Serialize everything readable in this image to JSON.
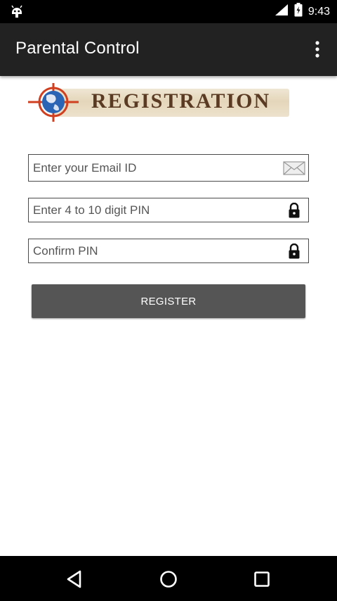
{
  "status_bar": {
    "time": "9:43",
    "left_icon": "android-notification-icon",
    "right_icons": [
      "signal-icon",
      "battery-icon"
    ]
  },
  "app_bar": {
    "title": "Parental Control",
    "overflow_icon": "more-vert-icon"
  },
  "banner": {
    "text": "REGISTRATION",
    "icon": "globe-crosshair-icon"
  },
  "form": {
    "email_placeholder": "Enter your Email ID",
    "email_icon": "envelope-icon",
    "pin_placeholder": "Enter 4 to 10 digit PIN",
    "pin_icon": "lock-icon",
    "confirm_placeholder": "Confirm PIN",
    "confirm_icon": "lock-icon",
    "register_label": "REGISTER"
  },
  "nav_bar": {
    "icons": [
      "back-icon",
      "home-icon",
      "recents-icon"
    ]
  },
  "colors": {
    "app_bar": "#222222",
    "button": "#555555",
    "banner_text": "#5a3a22",
    "globe_blue": "#2a64b4",
    "crosshair_red": "#d04020"
  }
}
